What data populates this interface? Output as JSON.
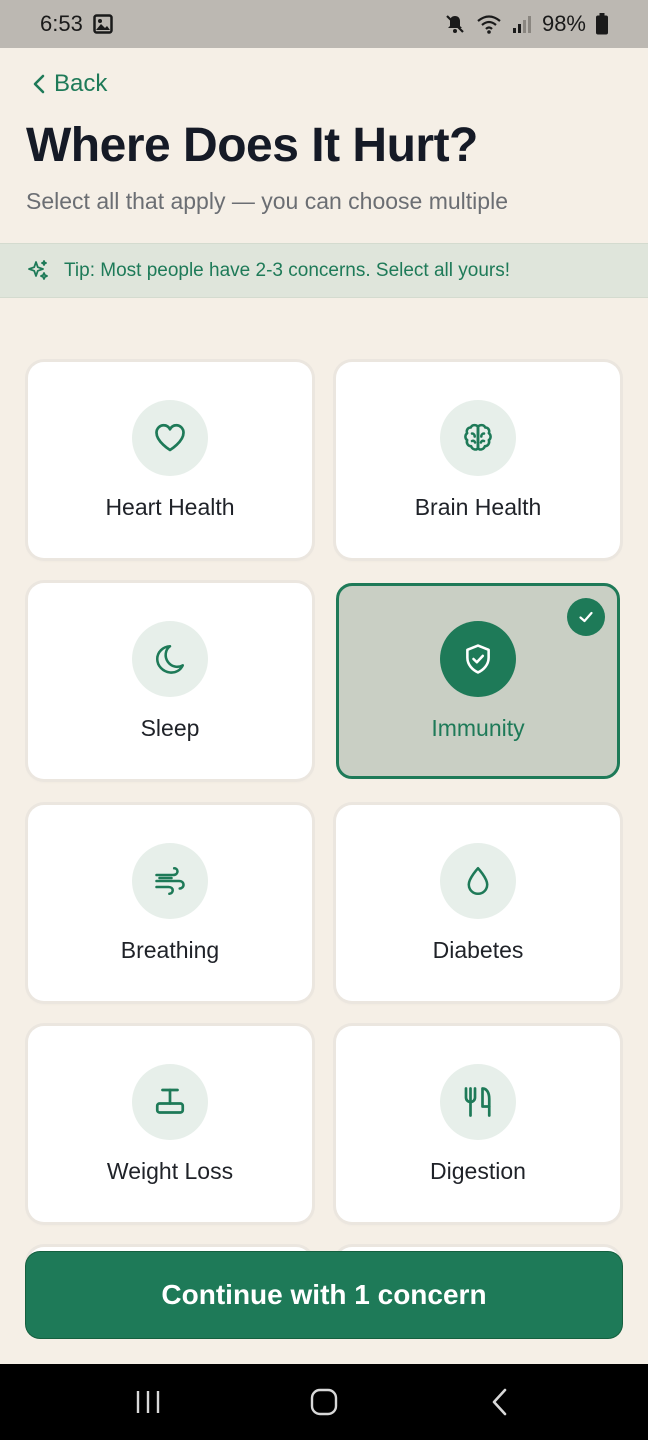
{
  "status_bar": {
    "time": "6:53",
    "battery": "98%"
  },
  "header": {
    "back_label": "Back",
    "title": "Where Does It Hurt?",
    "subtitle": "Select all that apply — you can choose multiple"
  },
  "tip": {
    "text": "Tip: Most people have 2-3 concerns. Select all yours!",
    "icon": "sparkles-icon"
  },
  "concerns": [
    {
      "label": "Heart Health",
      "icon": "heart-icon",
      "selected": false
    },
    {
      "label": "Brain Health",
      "icon": "brain-icon",
      "selected": false
    },
    {
      "label": "Sleep",
      "icon": "moon-icon",
      "selected": false
    },
    {
      "label": "Immunity",
      "icon": "shield-check-icon",
      "selected": true
    },
    {
      "label": "Breathing",
      "icon": "wind-icon",
      "selected": false
    },
    {
      "label": "Diabetes",
      "icon": "droplet-icon",
      "selected": false
    },
    {
      "label": "Weight Loss",
      "icon": "scale-icon",
      "selected": false
    },
    {
      "label": "Digestion",
      "icon": "utensils-icon",
      "selected": false
    }
  ],
  "continue_button": {
    "label": "Continue with 1 concern"
  },
  "colors": {
    "accent": "#1e7a58",
    "background": "#f5efe6",
    "selected_card": "#c9cfc4",
    "tip_background": "#dfe5db"
  }
}
